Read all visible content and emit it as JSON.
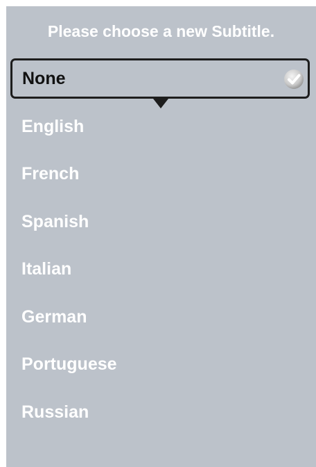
{
  "dialog": {
    "title": "Please choose a new Subtitle."
  },
  "selected_option": {
    "label": "None",
    "icon": "checkmark-icon"
  },
  "options": [
    {
      "label": "English"
    },
    {
      "label": "French"
    },
    {
      "label": "Spanish"
    },
    {
      "label": "Italian"
    },
    {
      "label": "German"
    },
    {
      "label": "Portuguese"
    },
    {
      "label": "Russian"
    }
  ],
  "colors": {
    "panel_background": "#bcc2ca",
    "option_text": "#ffffff",
    "selected_text": "#111111",
    "selection_border": "#1d1d1d"
  }
}
